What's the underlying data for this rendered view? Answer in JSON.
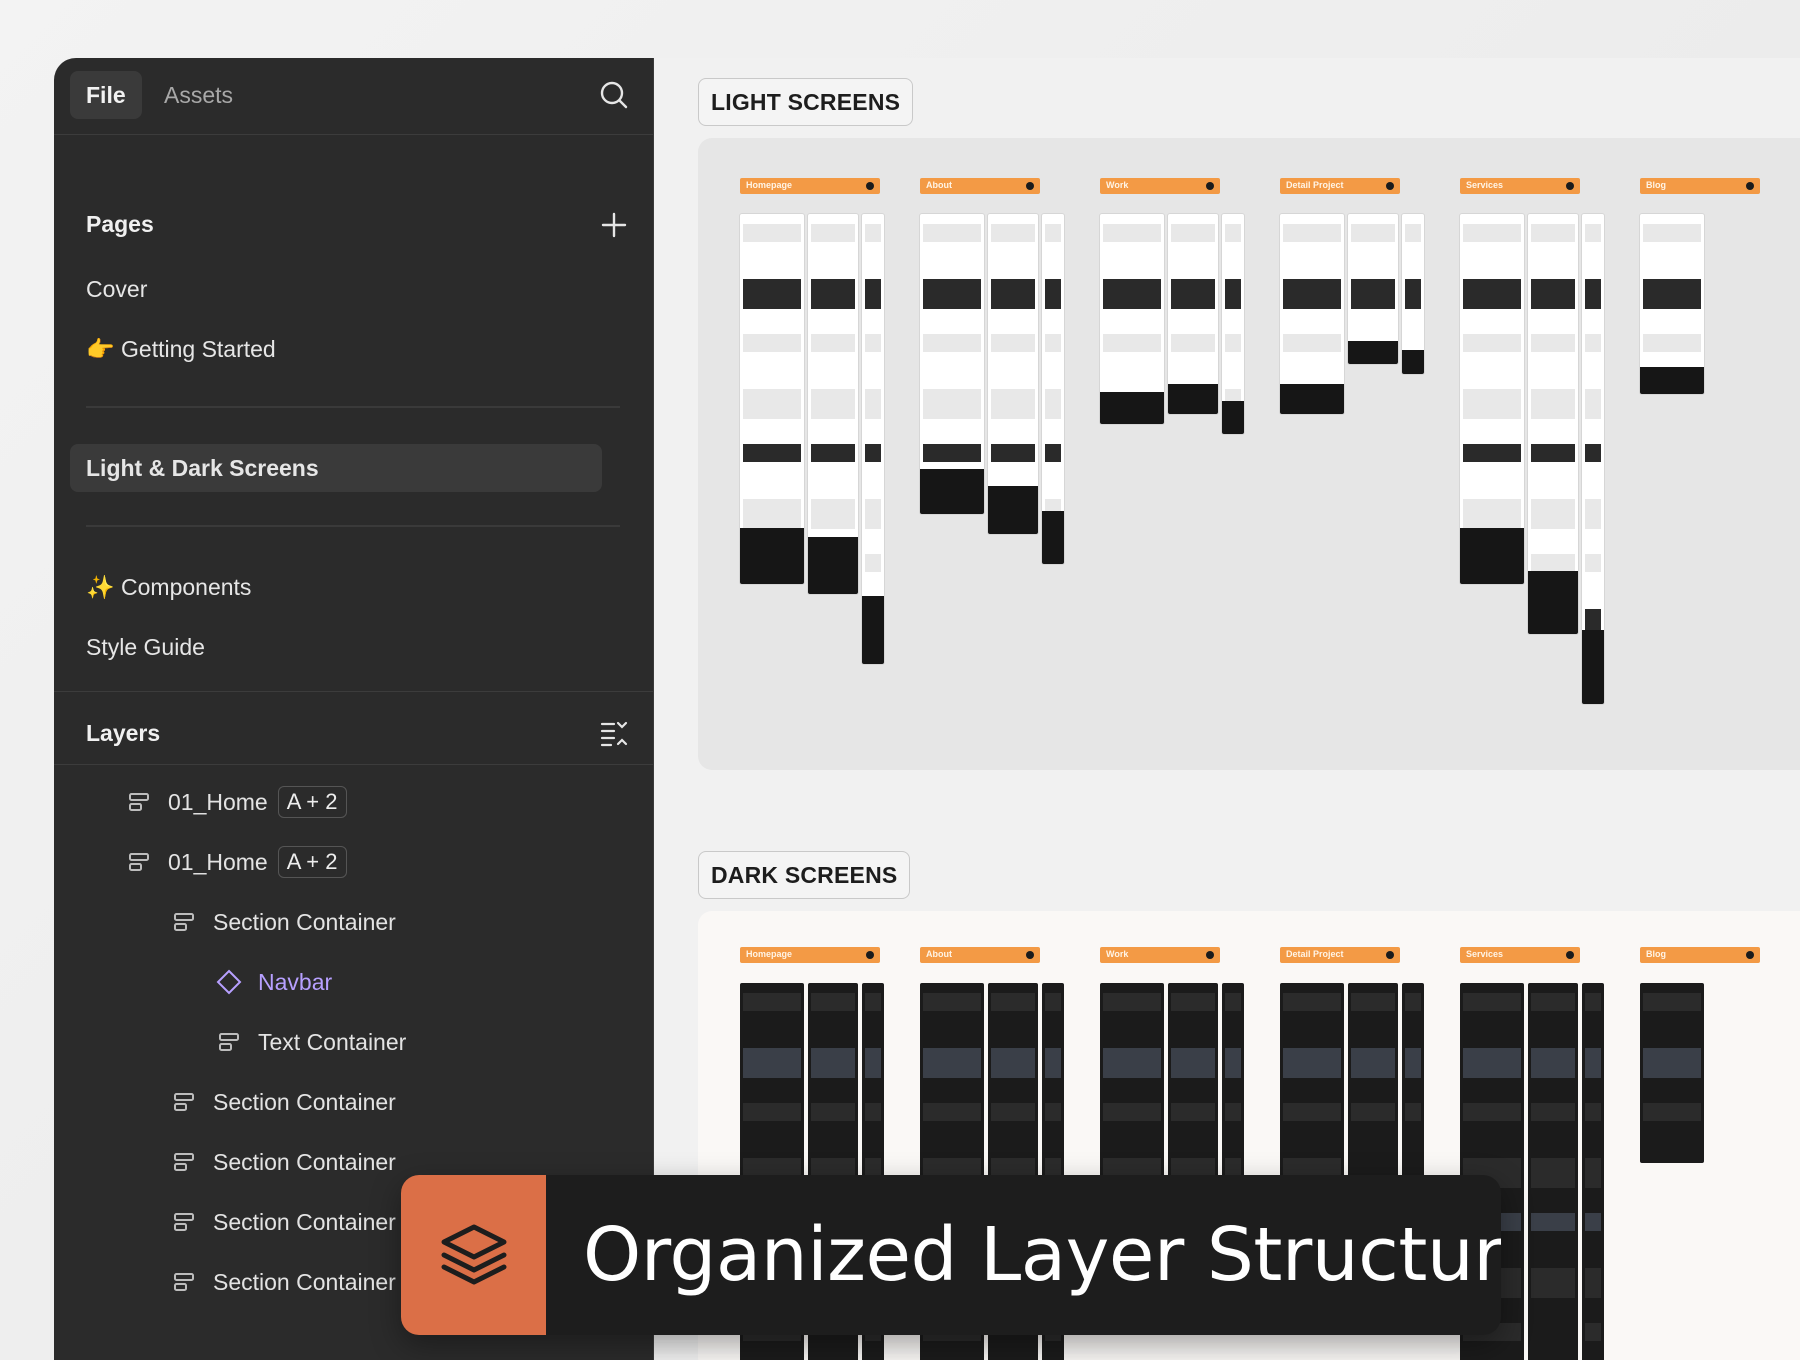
{
  "topbar": {
    "tabs": [
      {
        "label": "File",
        "active": true
      },
      {
        "label": "Assets",
        "active": false
      }
    ]
  },
  "pages": {
    "title": "Pages",
    "items": [
      {
        "label": "Cover"
      },
      {
        "label": "👉 Getting Started"
      },
      {
        "label": "Light & Dark Screens",
        "selected": true
      },
      {
        "label": "✨ Components"
      },
      {
        "label": "Style Guide"
      }
    ]
  },
  "layers": {
    "title": "Layers",
    "items": [
      {
        "label": "01_Home",
        "badge": "A + 2",
        "icon": "stack-icon"
      },
      {
        "label": "01_Home",
        "badge": "A + 2",
        "icon": "stack-icon"
      },
      {
        "label": "Section Container",
        "icon": "stack-icon"
      },
      {
        "label": "Navbar",
        "icon": "component-diamond-icon"
      },
      {
        "label": "Text Container",
        "icon": "stack-icon"
      },
      {
        "label": "Section Container",
        "icon": "stack-icon"
      },
      {
        "label": "Section Container",
        "icon": "stack-icon"
      },
      {
        "label": "Section Container",
        "icon": "stack-icon"
      },
      {
        "label": "Section Container",
        "icon": "stack-icon"
      }
    ]
  },
  "canvas": {
    "light_label": "LIGHT SCREENS",
    "dark_label": "DARK SCREENS",
    "screen_tags": [
      "Homepage",
      "About",
      "Work",
      "Detail Project",
      "Services",
      "Blog"
    ]
  },
  "banner": {
    "title": "Organized Layer Structure",
    "icon": "layers-stack-icon"
  },
  "colors": {
    "sidebar": "#2b2b2b",
    "accent_orange": "#f39a45",
    "banner_icon_bg": "#db6f47",
    "component_purple": "#b7a0ff"
  }
}
